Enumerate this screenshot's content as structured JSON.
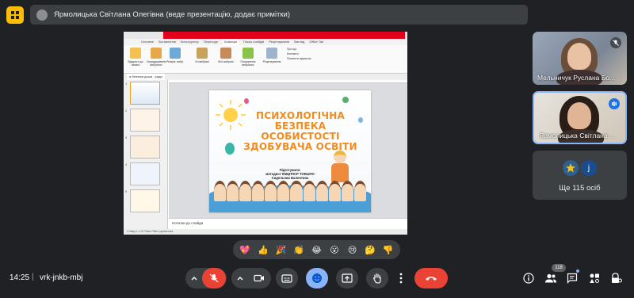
{
  "presenter_bar": {
    "label": "Ярмолицька Світлана Олегівна (веде презентацію, додає примітки)"
  },
  "ppt": {
    "tabs": [
      "Основне",
      "Вставлення",
      "Конструктор",
      "Переходи",
      "Анімація",
      "Показ слайдів",
      "Рецензування",
      "Вигляд",
      "Office Tab"
    ],
    "ribbon_labels": [
      "Відкрити до заміни",
      "Упорядкування вибраних",
      "Резерв. вибр.",
      "Усі вибрані",
      "Мої вибрані",
      "Поширення вибраних",
      "Рецензування",
      "Про що",
      "Контакти",
      "Помітити підписом"
    ],
    "doc_tab": "а безпека доша - ради",
    "thumbnail_numbers": [
      "1",
      "2",
      "3",
      "4",
      "5"
    ],
    "notes_placeholder": "Нотатки до слайда",
    "status_text": "Слайд 1 з 15   Тема Office   українська"
  },
  "slide": {
    "title_lines": [
      "ПСИХОЛОГІЧНА",
      "БЕЗПЕКА",
      "ОСОБИСТОСТІ",
      "ЗДОБУВАЧА ОСВІТИ"
    ],
    "prepared_label": "Підготувала:",
    "author_role": "методист КМЦППСР ТОКШПО",
    "author_name": "Сидельова Валентина"
  },
  "participants": [
    {
      "name": "Мельничук Руслана Бо...",
      "mic": "muted"
    },
    {
      "name": "Ярмолицька Світлана ...",
      "mic": "speaking"
    }
  ],
  "others": {
    "avatar_letter": "j",
    "label": "Ще 115 осіб"
  },
  "reactions": [
    "sparkling-heart",
    "thumbs-up",
    "party-popper",
    "clapping-hands",
    "joy",
    "surprised",
    "crying",
    "thinking",
    "thumbs-down"
  ],
  "reaction_glyphs": [
    "💖",
    "👍",
    "🎉",
    "👏",
    "😂",
    "😮",
    "😢",
    "🤔",
    "👎"
  ],
  "bottom": {
    "time": "14:25",
    "separator": "|",
    "meeting_code": "vrk-jnkb-mbj",
    "people_count": "118"
  },
  "colors": {
    "accent_red": "#ea4335",
    "accent_blue": "#8ab4f8",
    "slide_title": "#f28b1e",
    "top_left_button": "#fbbc04"
  }
}
